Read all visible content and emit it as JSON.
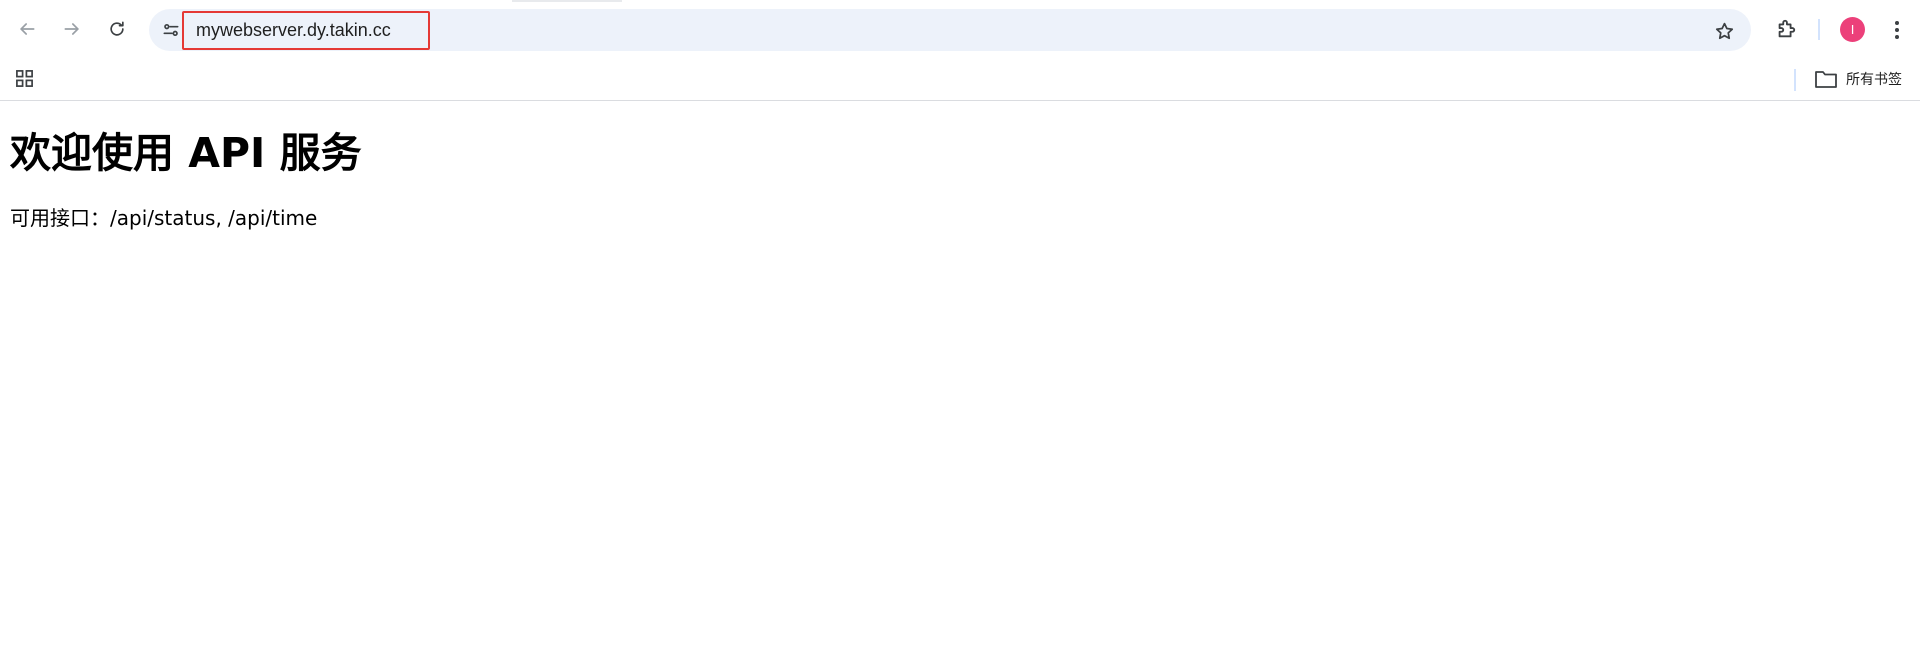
{
  "browser": {
    "url": "mywebserver.dy.takin.cc",
    "avatar_initial": "I",
    "accent_color": "#e53935",
    "avatar_color": "#ec407a",
    "icons": {
      "back": "arrow-left-icon",
      "forward": "arrow-right-icon",
      "reload": "reload-icon",
      "site_info": "tune-icon",
      "bookmark": "star-icon",
      "extensions": "puzzle-icon",
      "menu": "kebab-menu-icon",
      "apps": "apps-grid-icon",
      "folder": "folder-icon"
    }
  },
  "bookmarks_bar": {
    "all_bookmarks_label": "所有书签"
  },
  "page": {
    "heading": "欢迎使用 API 服务",
    "body_text": "可用接口：/api/status, /api/time"
  }
}
